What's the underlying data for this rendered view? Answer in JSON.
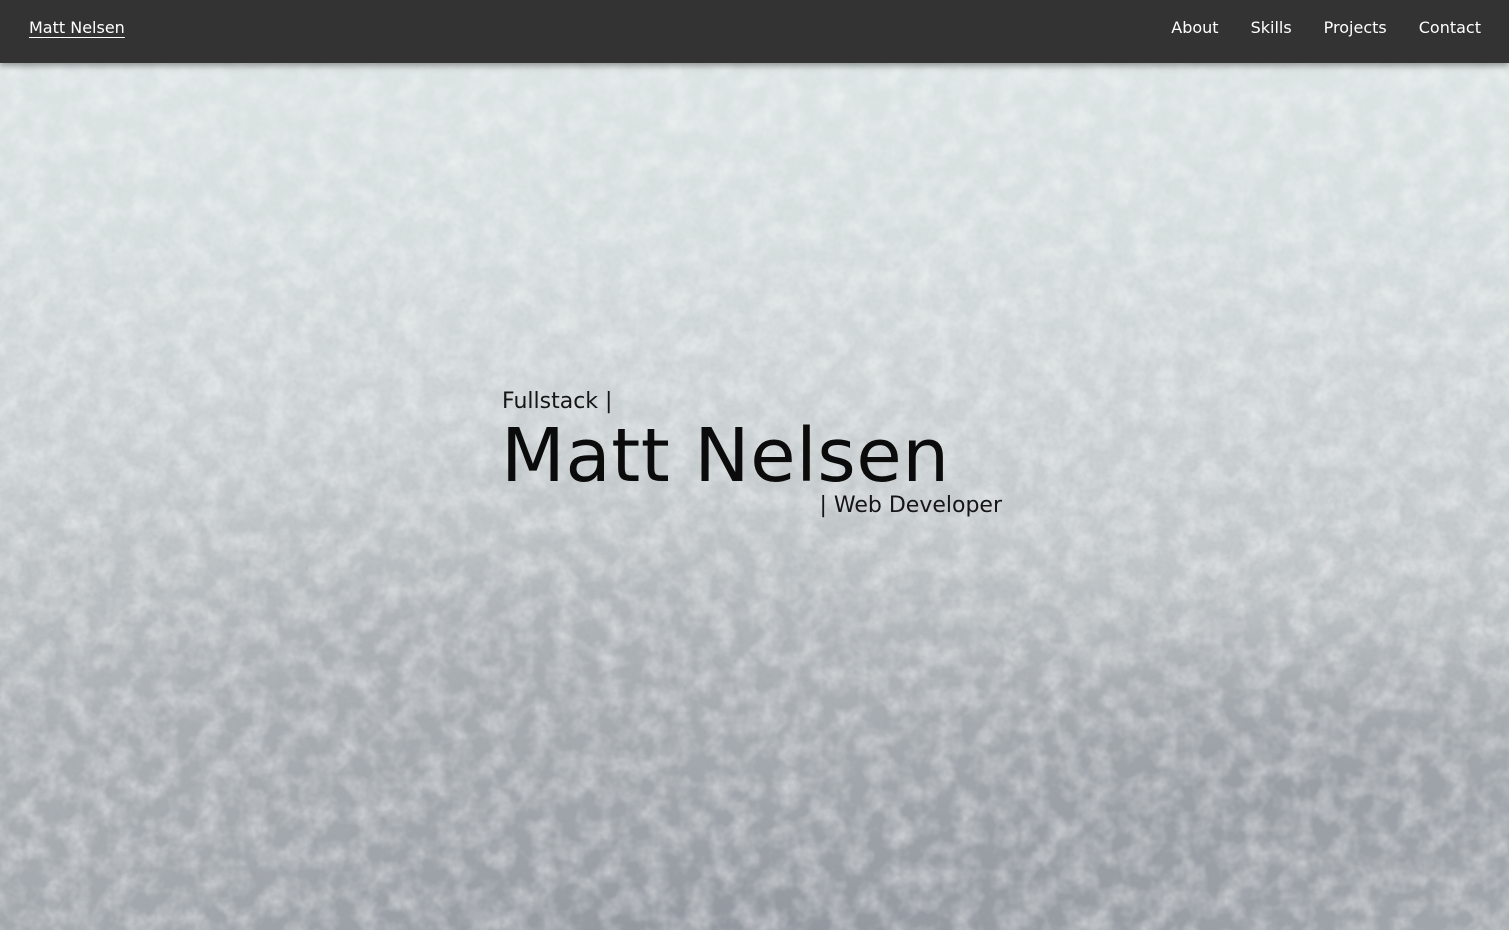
{
  "nav": {
    "brand": "Matt Nelsen",
    "links": [
      {
        "label": "About"
      },
      {
        "label": "Skills"
      },
      {
        "label": "Projects"
      },
      {
        "label": "Contact"
      }
    ]
  },
  "hero": {
    "pre": "Fullstack |",
    "name": "Matt Nelsen",
    "post": "| Web Developer"
  },
  "colors": {
    "navbar_bg": "#333333",
    "nav_text": "#ffffff",
    "hero_text": "#0b0b0b",
    "hero_bg_light": "#dfe6e6",
    "hero_bg_dark": "#a9aeb3"
  }
}
